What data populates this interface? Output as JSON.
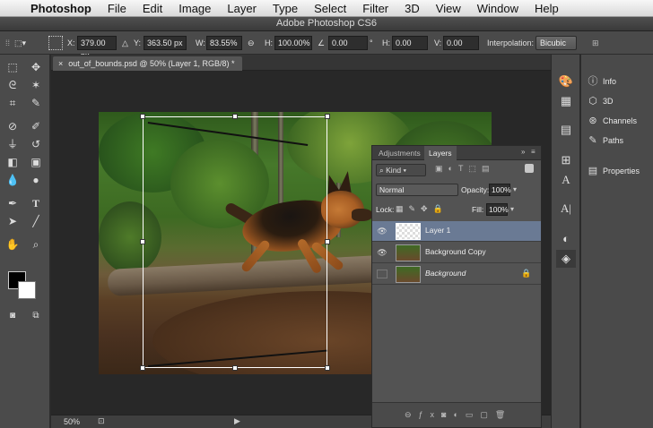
{
  "menubar": {
    "app_name": "Photoshop",
    "items": [
      "File",
      "Edit",
      "Image",
      "Layer",
      "Type",
      "Select",
      "Filter",
      "3D",
      "View",
      "Window",
      "Help"
    ]
  },
  "window": {
    "title": "Adobe Photoshop CS6"
  },
  "options_bar": {
    "x_label": "X:",
    "x_value": "379.00 px",
    "y_label": "Y:",
    "y_value": "363.50 px",
    "w_label": "W:",
    "w_value": "83.55%",
    "h_label": "H:",
    "h_value": "100.00%",
    "angle_value": "0.00",
    "hskew_label": "H:",
    "hskew_value": "0.00",
    "vskew_label": "V:",
    "vskew_value": "0.00",
    "interp_label": "Interpolation:",
    "interp_value": "Bicubic"
  },
  "document": {
    "tab_title": "out_of_bounds.psd @ 50% (Layer 1, RGB/8) *",
    "zoom": "50%"
  },
  "layers_panel": {
    "tab_adjustments": "Adjustments",
    "tab_layers": "Layers",
    "filter_kind": "Kind",
    "blend_mode": "Normal",
    "opacity_label": "Opacity:",
    "opacity_value": "100%",
    "lock_label": "Lock:",
    "fill_label": "Fill:",
    "fill_value": "100%",
    "layers": [
      {
        "name": "Layer 1",
        "selected": true,
        "visible": true
      },
      {
        "name": "Background Copy",
        "selected": false,
        "visible": true
      },
      {
        "name": "Background",
        "selected": false,
        "visible": false,
        "locked": true
      }
    ]
  },
  "right_panels": {
    "items": [
      "Info",
      "3D",
      "Channels",
      "Paths",
      "Properties"
    ]
  },
  "colors": {
    "foreground": "#000000",
    "background": "#ffffff",
    "selected_layer": "#6a7a94"
  }
}
